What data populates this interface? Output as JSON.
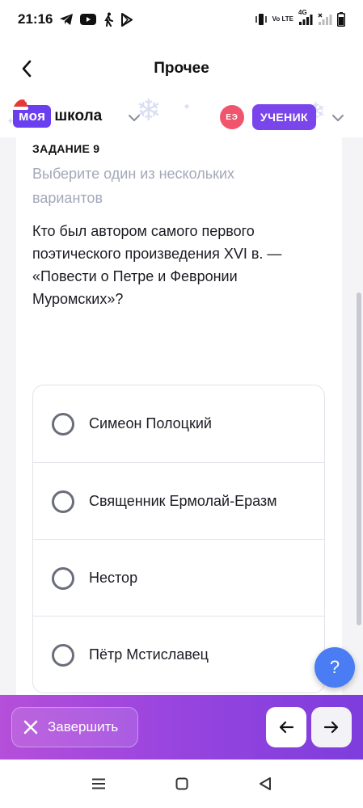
{
  "status_bar": {
    "time": "21:16",
    "network_label": "Vo LTE",
    "network_type": "4G",
    "left_icons": [
      "telegram-icon",
      "youtube-icon",
      "walk-icon",
      "play-store-icon"
    ],
    "right_icons": [
      "vibrate-icon",
      "volte-icon",
      "signal-icon",
      "signal-icon-2",
      "battery-icon"
    ]
  },
  "header": {
    "title": "Прочее"
  },
  "brand": {
    "logo_part1": "моя",
    "logo_part2": "школа",
    "avatar_initials": "ЕЭ",
    "role": "УЧЕНИК"
  },
  "task": {
    "number_label": "ЗАДАНИЕ 9",
    "hint": "Выберите один из нескольких вариантов",
    "question": "Кто был автором самого первого поэтического произведения XVI в. — «Повести о Петре и Февронии Муромских»?",
    "options": [
      {
        "label": "Симеон Полоцкий",
        "selected": false
      },
      {
        "label": "Священник Ермолай-Еразм",
        "selected": false
      },
      {
        "label": "Нестор",
        "selected": false
      },
      {
        "label": "Пётр Мстиславец",
        "selected": false
      }
    ]
  },
  "help": {
    "label": "?"
  },
  "actions": {
    "finish_label": "Завершить"
  },
  "colors": {
    "brand_purple": "#6a3ff0",
    "role_badge": "#7a45ea",
    "avatar": "#f0556d",
    "help_button": "#4a7df3",
    "action_bar_start": "#b54fd9",
    "action_bar_end": "#7d3ddc"
  }
}
